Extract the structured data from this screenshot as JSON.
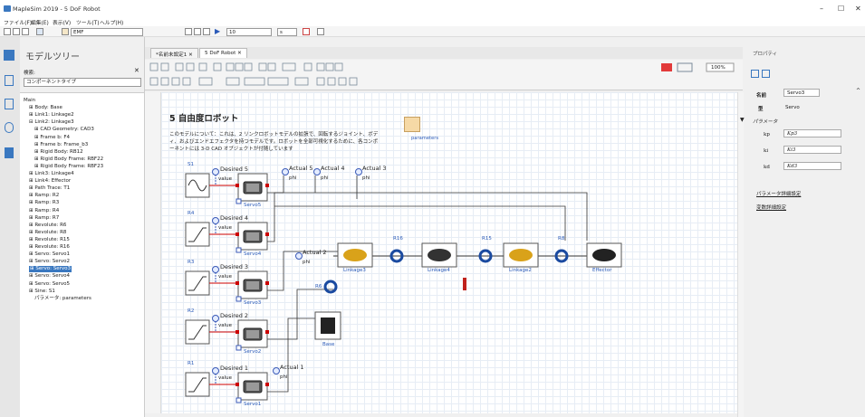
{
  "window": {
    "title": "MapleSim 2019 - 5 DoF Robot",
    "minimize": "–",
    "maximize": "☐",
    "close": "✕"
  },
  "menu": [
    "ファイル(F)",
    "編集(E)",
    "表示(V)",
    "ツール(T)",
    "ヘルプ(H)"
  ],
  "toolbar": {
    "search_value": "EMF",
    "time_value": "10",
    "unit_value": "s"
  },
  "left": {
    "title": "モデルツリー",
    "search_label": "検索:",
    "filter_value": "コンポーネントタイプ",
    "tree": [
      {
        "label": "Main",
        "indent": 0
      },
      {
        "label": "⊞ Body: Base",
        "indent": 1
      },
      {
        "label": "⊞ Link1: Linkage2",
        "indent": 1
      },
      {
        "label": "⊟ Link2: Linkage3",
        "indent": 1
      },
      {
        "label": "⊞ CAD Geometry: CAD3",
        "indent": 2
      },
      {
        "label": "⊞ Frame b: F4",
        "indent": 2
      },
      {
        "label": "⊞ Frame b: Frame_b3",
        "indent": 2
      },
      {
        "label": "⊞ Rigid Body: RB12",
        "indent": 2
      },
      {
        "label": "⊞ Rigid Body Frame: RBF22",
        "indent": 2
      },
      {
        "label": "⊞ Rigid Body Frame: RBF23",
        "indent": 2
      },
      {
        "label": "⊞ Link3: Linkage4",
        "indent": 1
      },
      {
        "label": "⊞ Link4: Effector",
        "indent": 1
      },
      {
        "label": "⊞ Path Trace: T1",
        "indent": 1
      },
      {
        "label": "⊞ Ramp: R2",
        "indent": 1
      },
      {
        "label": "⊞ Ramp: R3",
        "indent": 1
      },
      {
        "label": "⊞ Ramp: R4",
        "indent": 1
      },
      {
        "label": "⊞ Ramp: R7",
        "indent": 1
      },
      {
        "label": "⊞ Revolute: R6",
        "indent": 1
      },
      {
        "label": "⊞ Revolute: R8",
        "indent": 1
      },
      {
        "label": "⊞ Revolute: R15",
        "indent": 1
      },
      {
        "label": "⊞ Revolute: R16",
        "indent": 1
      },
      {
        "label": "⊞ Servo: Servo1",
        "indent": 1
      },
      {
        "label": "⊞ Servo: Servo2",
        "indent": 1
      },
      {
        "label": "⊞ Servo: Servo3",
        "indent": 1,
        "selected": true
      },
      {
        "label": "⊞ Servo: Servo4",
        "indent": 1
      },
      {
        "label": "⊞ Servo: Servo5",
        "indent": 1
      },
      {
        "label": "⊞ Sine: S1",
        "indent": 1
      },
      {
        "label": "パラメータ: parameters",
        "indent": 2
      }
    ]
  },
  "tabs": [
    "*名前未設定1 ✕",
    "5 DoF Robot ✕"
  ],
  "zoom": "100%",
  "diagram": {
    "title": "5 自由度ロボット",
    "description1": "このモデルについて：これは、2 リンクロボットモデルの拡張で、回転するジョイント、ボデ",
    "description2": "ィ、およびエンドエフェクタを持つモデルです。ロボットを全部可視化するために、各コンポ",
    "description3": "ーネントには 3-D CAD オブジェクトが付随しています",
    "parameters_label": "parameters",
    "desired": [
      "Desired 5",
      "Desired 4",
      "Desired 3",
      "Desired 2",
      "Desired 1"
    ],
    "sources": [
      "S1",
      "R4",
      "R3",
      "R2",
      "R1"
    ],
    "value": "value",
    "servos": [
      "Servo5",
      "Servo4",
      "Servo3",
      "Servo2",
      "Servo1"
    ],
    "actual": [
      "Actual 5",
      "Actual 4",
      "Actual 3",
      "Actual 2",
      "Actual 1"
    ],
    "phi": "phi",
    "revolutes": [
      "R16",
      "R15",
      "R8",
      "R6"
    ],
    "links": [
      "Linkage3",
      "Linkage4",
      "Linkage2",
      "Effector"
    ],
    "base": "Base"
  },
  "right": {
    "title": "プロパティ",
    "name_label": "名前",
    "name_value": "Servo3",
    "type_label": "型",
    "type_value": "Servo",
    "params_header": "パラメータ",
    "params": [
      {
        "name": "kp",
        "value": "Kp3"
      },
      {
        "name": "ki",
        "value": "Ki3"
      },
      {
        "name": "kd",
        "value": "Kd3"
      }
    ],
    "link1": "パラメータ詳細設定",
    "link2": "変数詳細設定"
  }
}
